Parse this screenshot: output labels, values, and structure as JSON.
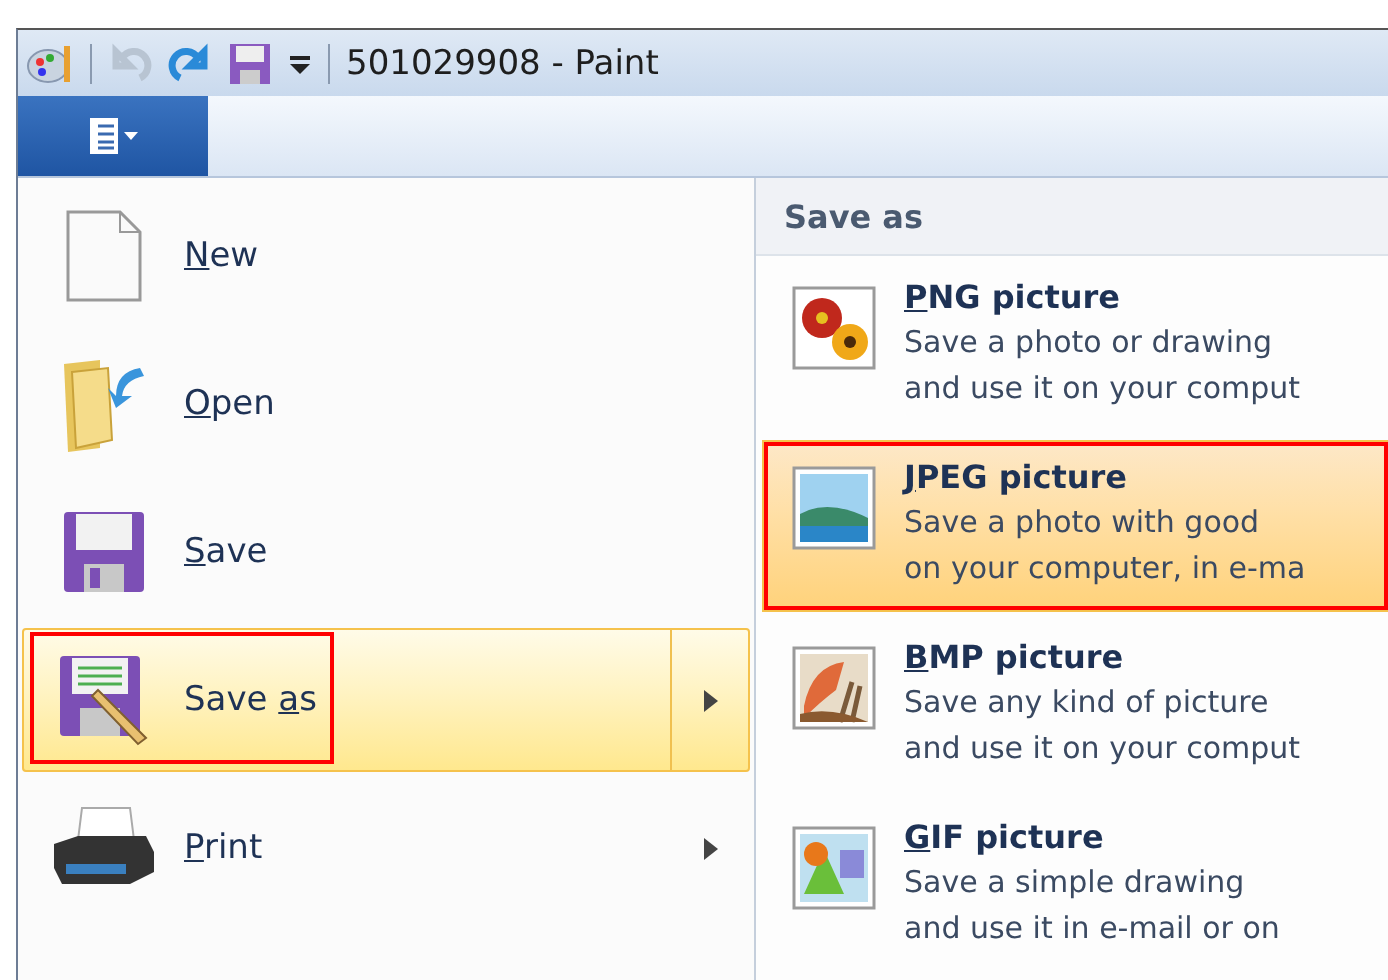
{
  "window": {
    "title": "501029908 - Paint"
  },
  "quick_access": [
    {
      "kind": "undo",
      "disabled": true
    },
    {
      "kind": "redo",
      "disabled": false
    },
    {
      "kind": "save",
      "disabled": false
    },
    {
      "kind": "customize",
      "disabled": false
    }
  ],
  "file_menu": {
    "items": [
      {
        "kind": "new",
        "key": "N",
        "post": "ew",
        "selected": false,
        "submenu": false,
        "annotated": false
      },
      {
        "kind": "open",
        "key": "O",
        "post": "pen",
        "selected": false,
        "submenu": false,
        "annotated": false
      },
      {
        "kind": "save",
        "key": "S",
        "post": "ave",
        "selected": false,
        "submenu": false,
        "annotated": false
      },
      {
        "kind": "saveas",
        "pre": "Save ",
        "key": "a",
        "post": "s",
        "selected": true,
        "submenu": true,
        "annotated": true
      },
      {
        "kind": "print",
        "key": "P",
        "post": "rint",
        "selected": false,
        "submenu": true,
        "annotated": false
      }
    ]
  },
  "save_as_panel": {
    "title": "Save as",
    "items": [
      {
        "kind": "png",
        "key": "P",
        "post": "NG picture",
        "lines": [
          "Save a photo or drawing",
          "and use it on your comput"
        ],
        "selected": false,
        "annotated": false
      },
      {
        "kind": "jpeg",
        "key": "J",
        "post": "PEG picture",
        "lines": [
          "Save a photo with good",
          "on your computer, in e-ma"
        ],
        "selected": true,
        "annotated": true
      },
      {
        "kind": "bmp",
        "key": "B",
        "post": "MP picture",
        "lines": [
          "Save any kind of picture",
          "and use it on your comput"
        ],
        "selected": false,
        "annotated": false
      },
      {
        "kind": "gif",
        "key": "G",
        "post": "IF picture",
        "lines": [
          "Save a simple drawing",
          "and use it in e-mail or on"
        ],
        "selected": false,
        "annotated": false
      }
    ]
  }
}
